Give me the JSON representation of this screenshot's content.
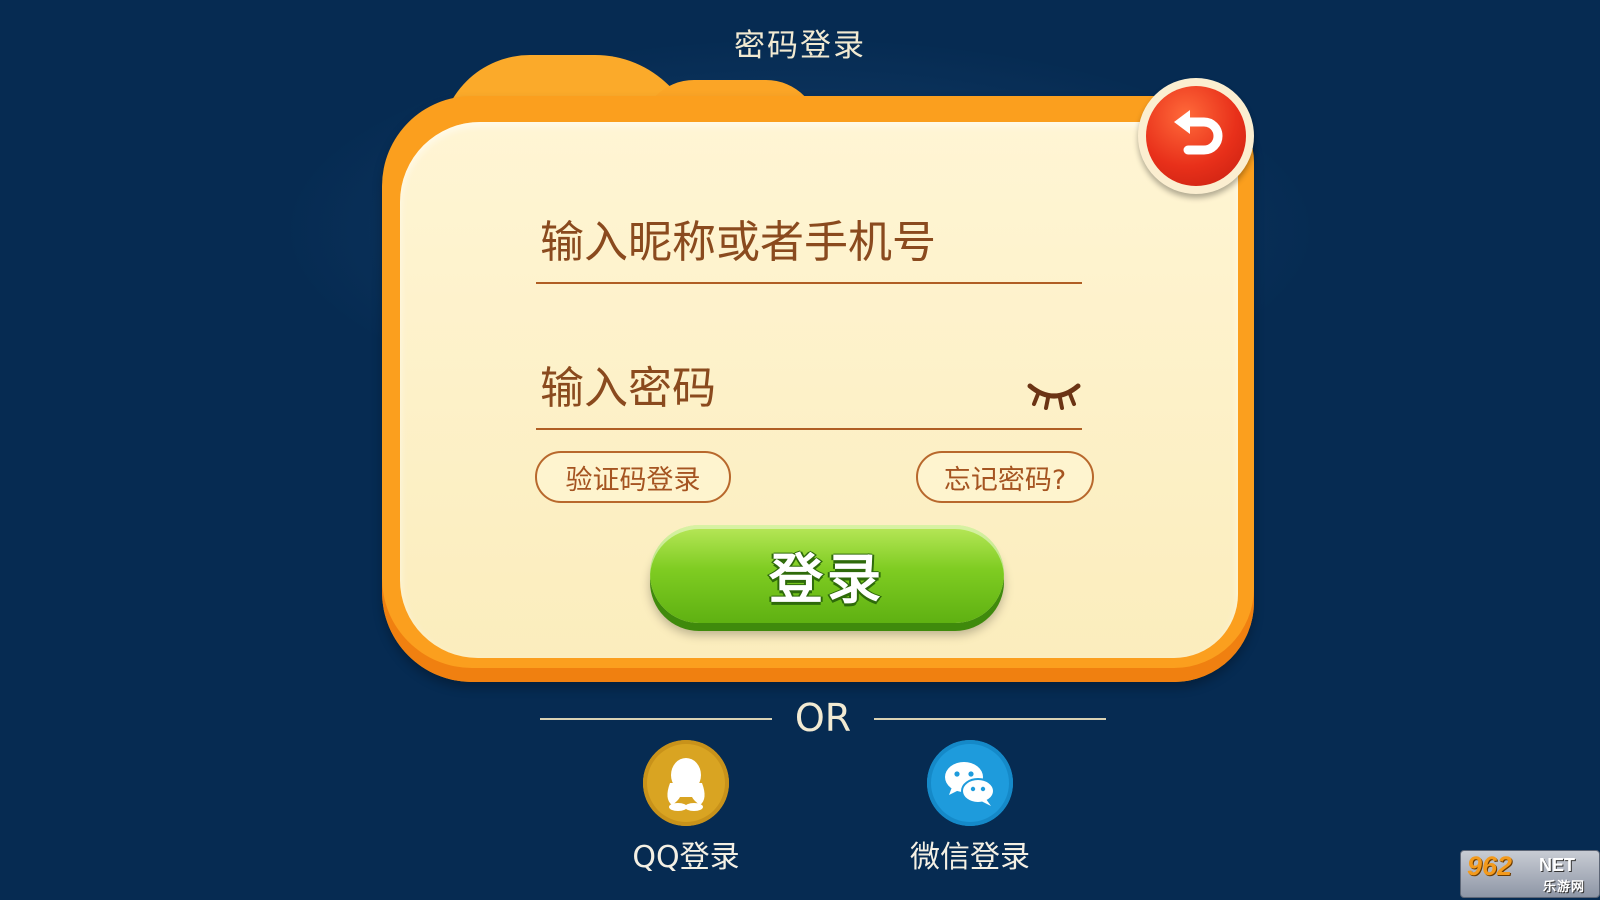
{
  "header": {
    "title": "密码登录"
  },
  "form": {
    "username_placeholder": "输入昵称或者手机号",
    "password_placeholder": "输入密码",
    "password_visibility_icon": "eye-closed-icon",
    "sms_login_label": "验证码登录",
    "forgot_password_label": "忘记密码?",
    "submit_label": "登录"
  },
  "back_button": {
    "icon": "undo-arrow-icon"
  },
  "divider": {
    "text": "OR"
  },
  "social": {
    "qq": {
      "label": "QQ登录",
      "icon": "qq-penguin-icon"
    },
    "wechat": {
      "label": "微信登录",
      "icon": "wechat-icon"
    }
  },
  "watermark": {
    "brand": "962",
    "suffix": "NET",
    "sub": "乐游网"
  },
  "colors": {
    "background": "#062b52",
    "card_frame": "#fb9f1e",
    "card_inner": "#fff5d4",
    "text_brown": "#8a4a1e",
    "login_green": "#7fcc22",
    "back_red": "#e8301a",
    "qq_gold": "#d9a422",
    "wechat_blue": "#1e9bdc"
  }
}
